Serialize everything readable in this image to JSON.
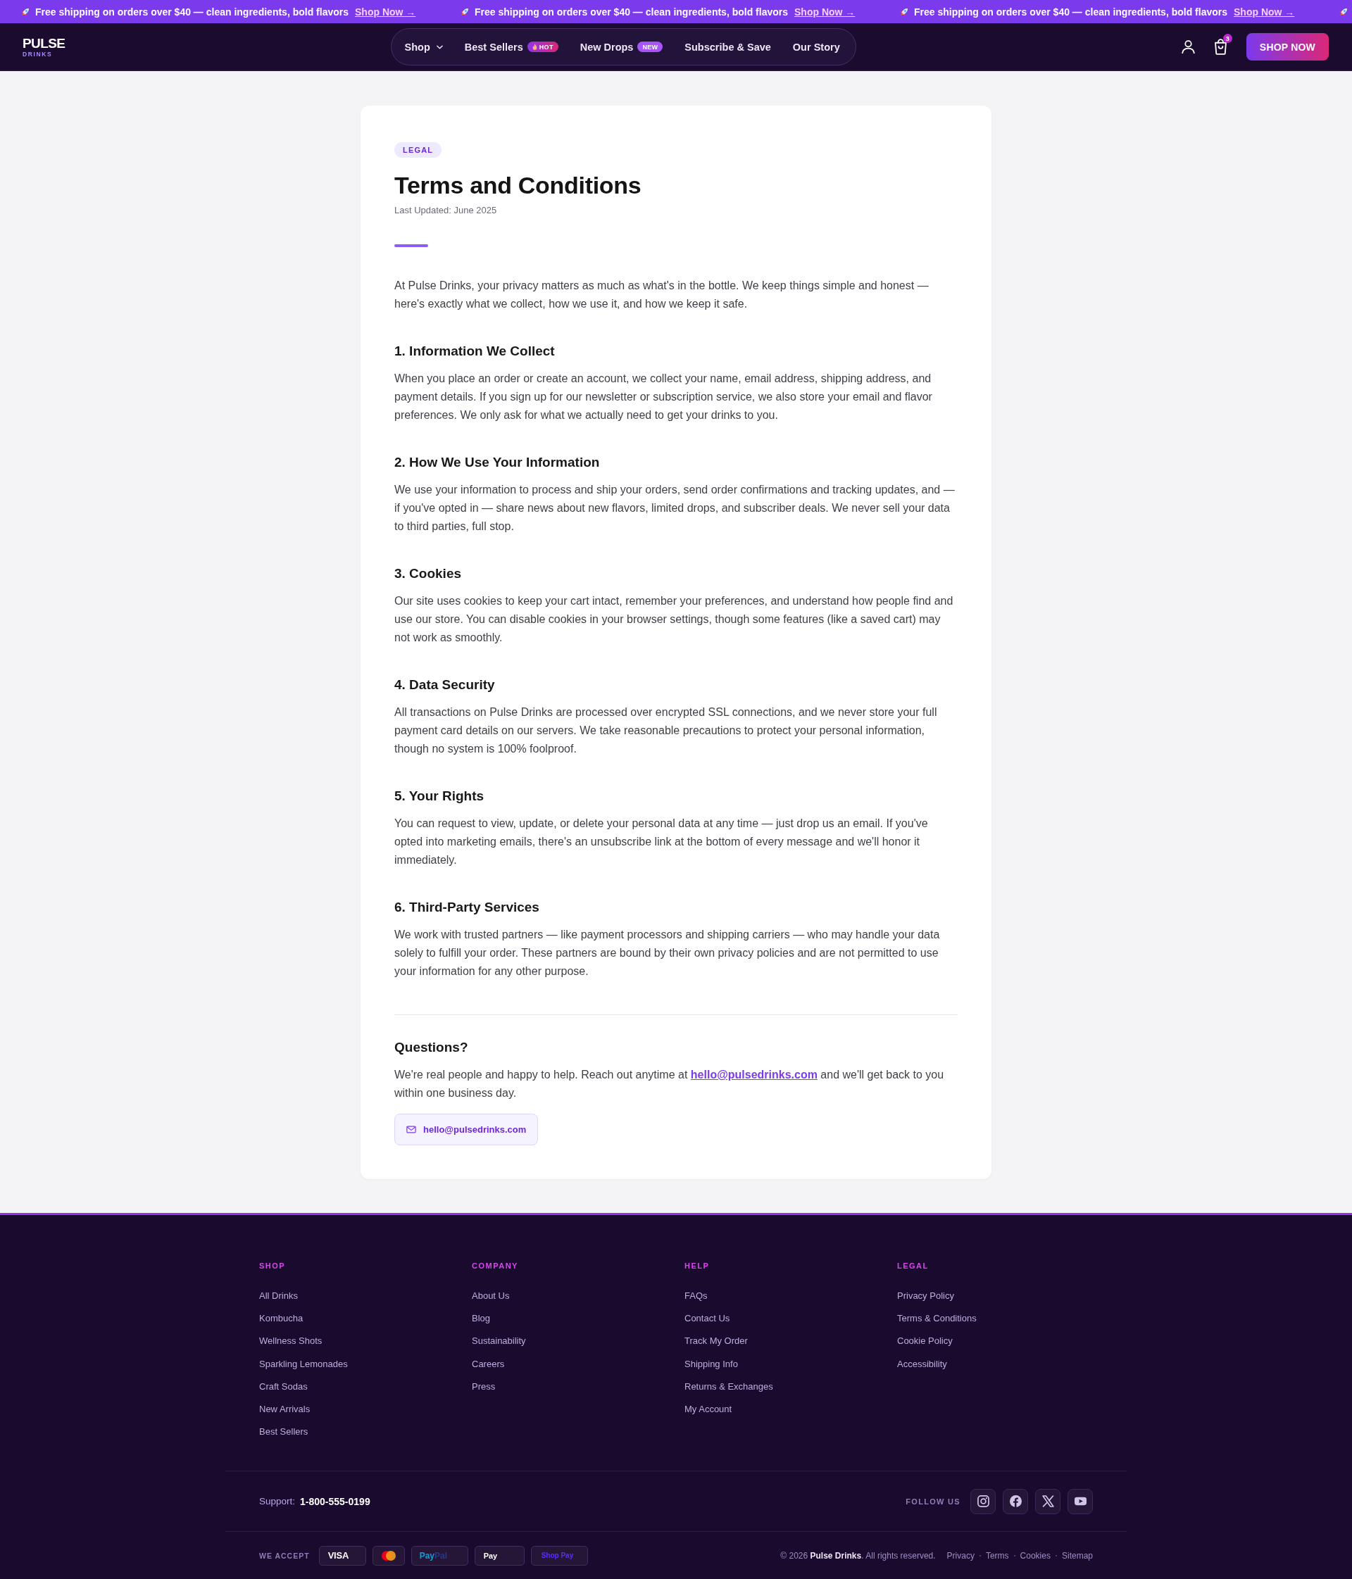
{
  "promo_banner": {
    "messages": [
      {
        "text": "Free shipping on orders over $40 — clean ingredients, bold flavors",
        "link": "Shop Now →"
      },
      {
        "text": "Free shipping on orders over $40 — clean ingredients, bold flavors",
        "link": "Shop Now →"
      },
      {
        "text": "Free shipping on orders over $40 — clean ingredients, bold flavors",
        "link": "Shop Now →"
      }
    ]
  },
  "header": {
    "logo": {
      "name": "PULSE",
      "tagline": "DRINKS"
    },
    "nav": [
      {
        "label": "Shop",
        "has_dropdown": true
      },
      {
        "label": "Best Sellers",
        "has_dropdown": false,
        "badge": {
          "kind": "hot",
          "text": "HOT"
        }
      },
      {
        "label": "New Drops",
        "has_dropdown": false,
        "badge": {
          "kind": "new",
          "text": "NEW"
        }
      },
      {
        "label": "Subscribe & Save",
        "has_dropdown": false
      },
      {
        "label": "Our Story",
        "has_dropdown": false
      }
    ],
    "cart_count": "3",
    "cta": "SHOP NOW"
  },
  "document": {
    "tag": "LEGAL",
    "title": "Terms and Conditions",
    "last_updated": "Last Updated: June 2025",
    "intro": "At Pulse Drinks, your privacy matters as much as what's in the bottle. We keep things simple and honest — here's exactly what we collect, how we use it, and how we keep it safe.",
    "sections": [
      {
        "heading": "1. Information We Collect",
        "body": "When you place an order or create an account, we collect your name, email address, shipping address, and payment details. If you sign up for our newsletter or subscription service, we also store your email and flavor preferences. We only ask for what we actually need to get your drinks to you."
      },
      {
        "heading": "2. How We Use Your Information",
        "body": "We use your information to process and ship your orders, send order confirmations and tracking updates, and — if you've opted in — share news about new flavors, limited drops, and subscriber deals. We never sell your data to third parties, full stop."
      },
      {
        "heading": "3. Cookies",
        "body": "Our site uses cookies to keep your cart intact, remember your preferences, and understand how people find and use our store. You can disable cookies in your browser settings, though some features (like a saved cart) may not work as smoothly."
      },
      {
        "heading": "4. Data Security",
        "body": "All transactions on Pulse Drinks are processed over encrypted SSL connections, and we never store your full payment card details on our servers. We take reasonable precautions to protect your personal information, though no system is 100% foolproof."
      },
      {
        "heading": "5. Your Rights",
        "body": "You can request to view, update, or delete your personal data at any time — just drop us an email. If you've opted into marketing emails, there's an unsubscribe link at the bottom of every message and we'll honor it immediately."
      },
      {
        "heading": "6. Third-Party Services",
        "body": "We work with trusted partners — like payment processors and shipping carriers — who may handle your data solely to fulfill your order. These partners are bound by their own privacy policies and are not permitted to use your information for any other purpose."
      }
    ],
    "questions": {
      "heading": "Questions?",
      "text_before": "We're real people and happy to help. Reach out anytime at ",
      "link": "hello@pulsedrinks.com",
      "text_after": " and we'll get back to you within one business day.",
      "button": "hello@pulsedrinks.com"
    }
  },
  "footer": {
    "columns": [
      {
        "heading": "SHOP",
        "links": [
          "All Drinks",
          "Kombucha",
          "Wellness Shots",
          "Sparkling Lemonades",
          "Craft Sodas",
          "New Arrivals",
          "Best Sellers"
        ]
      },
      {
        "heading": "COMPANY",
        "links": [
          "About Us",
          "Blog",
          "Sustainability",
          "Careers",
          "Press"
        ]
      },
      {
        "heading": "HELP",
        "links": [
          "FAQs",
          "Contact Us",
          "Track My Order",
          "Shipping Info",
          "Returns & Exchanges",
          "My Account"
        ]
      },
      {
        "heading": "LEGAL",
        "links": [
          "Privacy Policy",
          "Terms & Conditions",
          "Cookie Policy",
          "Accessibility"
        ]
      }
    ],
    "support_label": "Support:",
    "support_phone": "1-800-555-0199",
    "follow_label": "FOLLOW US",
    "social": [
      {
        "kind": "instagram"
      },
      {
        "kind": "facebook"
      },
      {
        "kind": "x"
      },
      {
        "kind": "youtube"
      }
    ],
    "accept_label": "WE ACCEPT",
    "payments": [
      {
        "kind": "visa",
        "text": "VISA"
      },
      {
        "kind": "mastercard"
      },
      {
        "kind": "paypal",
        "text": "Pay",
        "text_2": "Pal"
      },
      {
        "kind": "applepay",
        "text": "Pay"
      },
      {
        "kind": "shoppay",
        "text": "Shop Pay"
      }
    ],
    "copyright": "© 2026 **Pulse Drinks**. All rights reserved.",
    "legal_links": [
      "Privacy",
      "Terms",
      "Cookies",
      "Sitemap"
    ]
  }
}
